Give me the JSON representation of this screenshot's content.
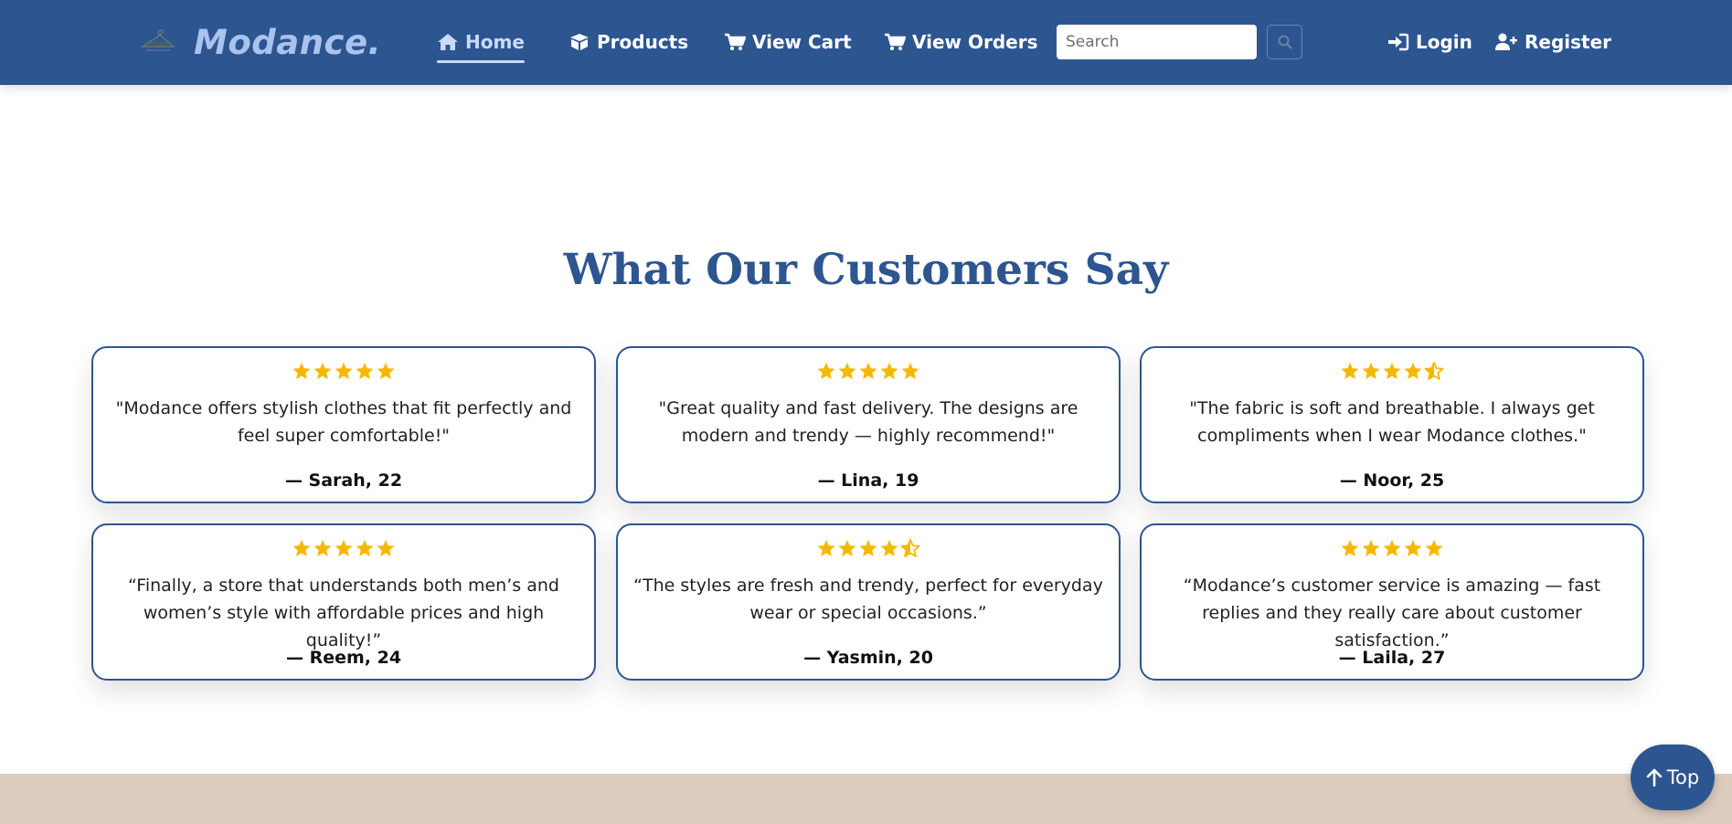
{
  "brand": {
    "name": "Modance.",
    "logo_text": "Modance"
  },
  "nav": {
    "home": "Home",
    "products": "Products",
    "view_cart": "View Cart",
    "view_orders": "View Orders",
    "login": "Login",
    "register": "Register"
  },
  "search": {
    "placeholder": "Search",
    "value": ""
  },
  "section": {
    "title": "What Our Customers Say"
  },
  "reviews": [
    {
      "rating": 5,
      "quote": "\"Modance offers stylish clothes that fit perfectly and feel super comfortable!\"",
      "author": "— Sarah, 22"
    },
    {
      "rating": 5,
      "quote": "\"Great quality and fast delivery. The designs are modern and trendy — highly recommend!\"",
      "author": "— Lina, 19"
    },
    {
      "rating": 4.5,
      "quote": "\"The fabric is soft and breathable. I always get compliments when I wear Modance clothes.\"",
      "author": "— Noor, 25"
    },
    {
      "rating": 5,
      "quote": "“Finally, a store that understands both men’s and women’s style with affordable prices and high quality!”",
      "author": "— Reem, 24"
    },
    {
      "rating": 4.5,
      "quote": "“The styles are fresh and trendy, perfect for everyday wear or special occasions.”",
      "author": "— Yasmin, 20"
    },
    {
      "rating": 5,
      "quote": "“Modance’s customer service is amazing — fast replies and they really care about customer satisfaction.”",
      "author": "— Laila, 27"
    }
  ],
  "back_to_top": {
    "label": "Top"
  },
  "colors": {
    "primary": "#2d5590",
    "star": "#f5b800",
    "footer": "#dbccbd"
  },
  "icons": [
    "home-icon",
    "box-icon",
    "cart-icon",
    "search-icon",
    "sign-in-icon",
    "user-plus-icon",
    "star-icon",
    "star-half-icon",
    "arrow-up-icon"
  ]
}
